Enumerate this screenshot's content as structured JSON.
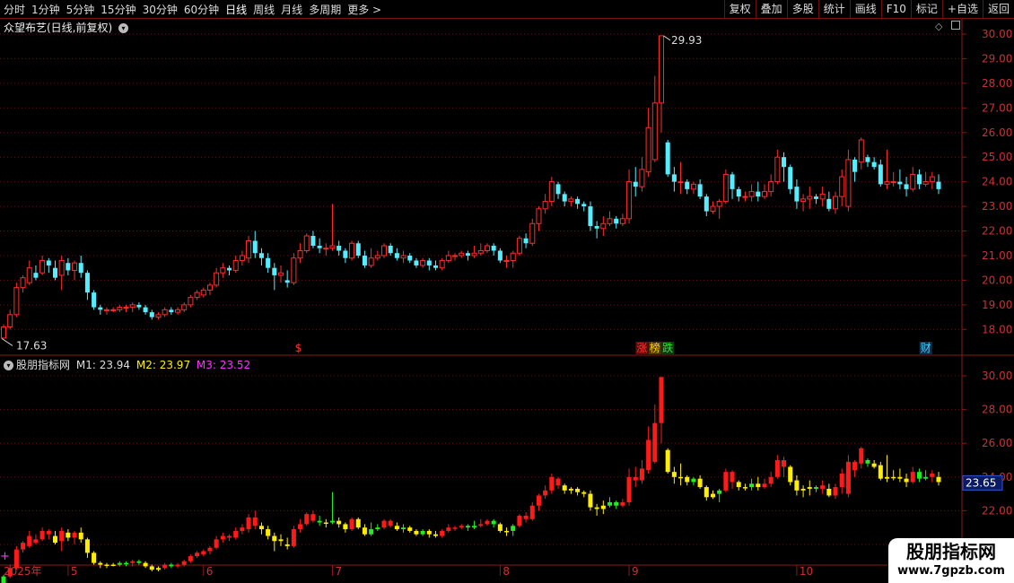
{
  "toolbar": {
    "periods": [
      {
        "label": "分时",
        "active": false
      },
      {
        "label": "1分钟",
        "active": false
      },
      {
        "label": "5分钟",
        "active": false
      },
      {
        "label": "15分钟",
        "active": false
      },
      {
        "label": "30分钟",
        "active": false
      },
      {
        "label": "60分钟",
        "active": false
      },
      {
        "label": "日线",
        "active": true
      },
      {
        "label": "周线",
        "active": false
      },
      {
        "label": "月线",
        "active": false
      },
      {
        "label": "多周期",
        "active": false
      },
      {
        "label": "更多 >",
        "active": false
      }
    ],
    "actions": [
      "复权",
      "叠加",
      "多股",
      "统计",
      "画线",
      "F10",
      "标记",
      "+自选",
      "返回"
    ]
  },
  "main_panel": {
    "title": "众望布艺(日线,前复权)",
    "price_labels": [
      "30.00",
      "29.00",
      "28.00",
      "27.00",
      "26.00",
      "25.00",
      "24.00",
      "23.00",
      "22.00",
      "21.00",
      "20.00",
      "19.00",
      "18.00"
    ],
    "high_label": "29.93",
    "low_label": "17.63",
    "markers": [
      {
        "text": "$",
        "color": "#ff3030",
        "after_candle": 46
      },
      {
        "text": "涨",
        "color": "#ff3030",
        "after_candle": 99,
        "bg": "#5a1010"
      },
      {
        "text": "榜",
        "color": "#ffcc00",
        "after_candle": 101,
        "bg": "#4a3800"
      },
      {
        "text": "跌",
        "color": "#33dd33",
        "after_candle": 103,
        "bg": "#103a10"
      },
      {
        "text": "财",
        "color": "#44ccff",
        "after_candle": 143,
        "bg": "#10304a"
      }
    ]
  },
  "indicator_panel": {
    "name": "股朋指标网",
    "m1_label": "M1: 23.94",
    "m2_label": "M2: 23.97",
    "m3_label": "M3: 23.52",
    "price_labels": [
      "30.00",
      "28.00",
      "26.00",
      "24.00",
      "22.00",
      "20.00"
    ],
    "current_value": "23.65"
  },
  "date_axis": {
    "labels": [
      "2025年",
      "5",
      "6",
      "7",
      "8",
      "9",
      "10"
    ]
  },
  "watermark": {
    "line1": "股朋指标网",
    "line2": "www.7gpzb.com"
  },
  "chart_data": {
    "type": "candlestick",
    "title": "众望布艺(日线,前复权)",
    "ylim": [
      17.1,
      30.4
    ],
    "colors": {
      "up": "#ff2c2c",
      "down": "#55eeff",
      "ind_red": "#ff1a1a",
      "ind_yellow": "#ffee00",
      "ind_green": "#22ee22"
    },
    "candles": [
      [
        17.65,
        18.1,
        18.2,
        17.63
      ],
      [
        18.1,
        18.6,
        18.8,
        18.0
      ],
      [
        18.6,
        19.7,
        19.9,
        18.5
      ],
      [
        19.7,
        20.1,
        20.2,
        19.5
      ],
      [
        19.9,
        20.5,
        20.8,
        19.8
      ],
      [
        20.3,
        20.1,
        20.6,
        20.0
      ],
      [
        20.3,
        20.8,
        21.0,
        20.2
      ],
      [
        20.8,
        20.6,
        20.9,
        20.3
      ],
      [
        20.5,
        20.1,
        20.8,
        20.0
      ],
      [
        20.2,
        20.8,
        21.0,
        19.6
      ],
      [
        20.7,
        20.4,
        20.9,
        20.2
      ],
      [
        20.4,
        20.7,
        20.8,
        20.0
      ],
      [
        20.7,
        20.3,
        21.0,
        20.1
      ],
      [
        20.3,
        19.5,
        20.4,
        19.2
      ],
      [
        19.5,
        18.9,
        19.6,
        18.8
      ],
      [
        18.9,
        18.8,
        19.0,
        18.6
      ],
      [
        18.8,
        18.8,
        18.9,
        18.6
      ],
      [
        18.8,
        18.8,
        18.9,
        18.7
      ],
      [
        18.8,
        18.9,
        19.0,
        18.7
      ],
      [
        18.9,
        18.9,
        19.0,
        18.7
      ],
      [
        18.9,
        19.0,
        19.1,
        18.7
      ],
      [
        19.0,
        18.9,
        19.1,
        18.8
      ],
      [
        18.9,
        18.7,
        19.0,
        18.6
      ],
      [
        18.7,
        18.5,
        18.8,
        18.4
      ],
      [
        18.5,
        18.6,
        18.7,
        18.4
      ],
      [
        18.6,
        18.8,
        18.9,
        18.5
      ],
      [
        18.8,
        18.7,
        18.9,
        18.6
      ],
      [
        18.7,
        18.8,
        18.9,
        18.6
      ],
      [
        18.8,
        19.0,
        19.1,
        18.7
      ],
      [
        19.0,
        19.3,
        19.4,
        18.9
      ],
      [
        19.3,
        19.5,
        19.6,
        19.2
      ],
      [
        19.4,
        19.6,
        19.7,
        19.3
      ],
      [
        19.6,
        19.8,
        19.9,
        19.4
      ],
      [
        19.8,
        20.3,
        20.5,
        19.7
      ],
      [
        20.3,
        20.5,
        20.7,
        20.1
      ],
      [
        20.5,
        20.4,
        20.6,
        20.2
      ],
      [
        20.4,
        20.8,
        21.0,
        20.3
      ],
      [
        20.8,
        21.0,
        21.2,
        20.6
      ],
      [
        20.9,
        21.6,
        21.8,
        20.7
      ],
      [
        21.6,
        21.1,
        22.0,
        20.9
      ],
      [
        21.1,
        20.9,
        21.3,
        20.6
      ],
      [
        20.9,
        20.5,
        21.1,
        20.3
      ],
      [
        20.5,
        20.2,
        20.7,
        19.6
      ],
      [
        20.2,
        20.3,
        20.6,
        19.9
      ],
      [
        20.0,
        19.9,
        20.4,
        19.7
      ],
      [
        19.9,
        20.9,
        21.1,
        19.8
      ],
      [
        20.9,
        21.2,
        21.5,
        20.7
      ],
      [
        21.2,
        21.8,
        21.9,
        21.1
      ],
      [
        21.8,
        21.4,
        22.0,
        21.3
      ],
      [
        21.4,
        21.3,
        21.7,
        21.1
      ],
      [
        21.3,
        21.3,
        21.5,
        21.0
      ],
      [
        21.3,
        21.4,
        23.1,
        21.2
      ],
      [
        21.4,
        21.2,
        21.6,
        21.0
      ],
      [
        21.2,
        20.9,
        21.3,
        20.7
      ],
      [
        20.9,
        21.5,
        21.6,
        20.8
      ],
      [
        21.5,
        21.0,
        21.6,
        20.9
      ],
      [
        21.0,
        20.6,
        21.2,
        20.5
      ],
      [
        20.6,
        20.9,
        21.3,
        20.5
      ],
      [
        20.9,
        21.0,
        21.2,
        20.8
      ],
      [
        21.0,
        21.4,
        21.5,
        20.9
      ],
      [
        21.4,
        21.1,
        21.5,
        21.0
      ],
      [
        21.1,
        20.9,
        21.3,
        20.8
      ],
      [
        20.9,
        21.0,
        21.2,
        20.7
      ],
      [
        21.0,
        20.8,
        21.1,
        20.7
      ],
      [
        20.8,
        20.6,
        20.9,
        20.5
      ],
      [
        20.6,
        20.8,
        20.9,
        20.5
      ],
      [
        20.8,
        20.6,
        20.9,
        20.4
      ],
      [
        20.6,
        20.5,
        20.8,
        20.4
      ],
      [
        20.5,
        20.8,
        20.9,
        20.4
      ],
      [
        20.8,
        21.0,
        21.2,
        20.7
      ],
      [
        21.0,
        21.0,
        21.1,
        20.8
      ],
      [
        21.0,
        21.1,
        21.2,
        20.9
      ],
      [
        21.1,
        21.0,
        21.2,
        20.8
      ],
      [
        21.0,
        21.1,
        21.4,
        20.9
      ],
      [
        21.1,
        21.2,
        21.5,
        21.0
      ],
      [
        21.2,
        21.4,
        21.5,
        21.1
      ],
      [
        21.4,
        21.2,
        21.5,
        21.0
      ],
      [
        21.2,
        20.8,
        21.3,
        20.7
      ],
      [
        20.8,
        20.8,
        21.0,
        20.5
      ],
      [
        20.8,
        21.1,
        21.2,
        20.5
      ],
      [
        21.1,
        21.7,
        21.8,
        21.0
      ],
      [
        21.7,
        21.5,
        21.9,
        21.3
      ],
      [
        21.5,
        22.3,
        22.5,
        21.4
      ],
      [
        22.3,
        22.9,
        23.0,
        22.0
      ],
      [
        22.9,
        23.2,
        23.5,
        22.7
      ],
      [
        23.2,
        24.0,
        24.2,
        23.0
      ],
      [
        23.9,
        23.5,
        24.0,
        23.3
      ],
      [
        23.5,
        23.2,
        23.6,
        23.0
      ],
      [
        23.2,
        23.3,
        23.4,
        23.0
      ],
      [
        23.3,
        23.1,
        23.4,
        22.9
      ],
      [
        23.1,
        23.0,
        23.2,
        22.8
      ],
      [
        23.0,
        22.2,
        23.2,
        22.0
      ],
      [
        22.2,
        22.1,
        22.4,
        21.7
      ],
      [
        22.1,
        22.3,
        22.6,
        21.8
      ],
      [
        22.3,
        22.5,
        22.8,
        22.2
      ],
      [
        22.5,
        22.3,
        22.6,
        22.1
      ],
      [
        22.3,
        22.5,
        22.7,
        22.2
      ],
      [
        22.5,
        24.0,
        24.5,
        22.3
      ],
      [
        24.0,
        23.8,
        24.6,
        23.4
      ],
      [
        23.8,
        24.5,
        25.0,
        23.6
      ],
      [
        24.4,
        26.2,
        27.0,
        24.2
      ],
      [
        24.9,
        27.2,
        28.3,
        24.8
      ],
      [
        27.2,
        29.93,
        29.93,
        26.0
      ],
      [
        25.6,
        24.3,
        25.7,
        24.2
      ],
      [
        24.3,
        24.0,
        24.6,
        23.6
      ],
      [
        24.0,
        24.0,
        24.8,
        23.5
      ],
      [
        24.0,
        23.7,
        24.1,
        23.5
      ],
      [
        23.7,
        23.9,
        24.0,
        23.5
      ],
      [
        23.9,
        23.4,
        24.1,
        23.3
      ],
      [
        23.4,
        22.8,
        23.5,
        22.6
      ],
      [
        22.8,
        23.0,
        23.2,
        22.7
      ],
      [
        23.0,
        23.2,
        23.3,
        22.5
      ],
      [
        23.2,
        24.3,
        24.5,
        23.1
      ],
      [
        24.3,
        23.7,
        24.4,
        23.3
      ],
      [
        23.7,
        23.4,
        23.8,
        23.2
      ],
      [
        23.4,
        23.4,
        23.6,
        23.2
      ],
      [
        23.4,
        23.6,
        23.9,
        23.2
      ],
      [
        23.6,
        23.4,
        24.0,
        23.2
      ],
      [
        23.4,
        23.6,
        23.9,
        23.3
      ],
      [
        23.6,
        24.0,
        24.3,
        23.4
      ],
      [
        24.0,
        25.0,
        25.3,
        23.9
      ],
      [
        25.0,
        24.6,
        25.2,
        24.0
      ],
      [
        24.6,
        23.7,
        24.7,
        23.5
      ],
      [
        23.8,
        23.2,
        24.1,
        22.9
      ],
      [
        23.2,
        23.3,
        23.5,
        22.8
      ],
      [
        23.3,
        23.4,
        23.8,
        22.9
      ],
      [
        23.4,
        23.3,
        23.5,
        23.1
      ],
      [
        23.3,
        23.5,
        23.8,
        23.0
      ],
      [
        23.3,
        22.9,
        23.6,
        22.8
      ],
      [
        22.9,
        23.4,
        23.6,
        22.7
      ],
      [
        23.4,
        24.2,
        24.5,
        23.0
      ],
      [
        23.0,
        24.9,
        25.3,
        22.8
      ],
      [
        24.9,
        24.4,
        25.0,
        24.0
      ],
      [
        24.8,
        25.7,
        25.8,
        24.5
      ],
      [
        25.0,
        24.8,
        25.1,
        24.6
      ],
      [
        24.8,
        24.6,
        25.0,
        24.5
      ],
      [
        24.7,
        23.9,
        24.9,
        23.8
      ],
      [
        23.9,
        24.0,
        25.3,
        23.7
      ],
      [
        24.0,
        24.0,
        24.4,
        23.8
      ],
      [
        24.0,
        23.9,
        24.5,
        23.7
      ],
      [
        23.9,
        23.7,
        24.2,
        23.4
      ],
      [
        23.7,
        24.3,
        24.6,
        23.6
      ],
      [
        24.3,
        23.9,
        24.5,
        23.7
      ],
      [
        23.9,
        24.0,
        24.4,
        23.8
      ],
      [
        24.0,
        24.2,
        24.4,
        23.7
      ],
      [
        24.0,
        23.7,
        24.3,
        23.5
      ]
    ],
    "indicator": {
      "m1": 23.94,
      "m2": 23.97,
      "m3": 23.52,
      "current": 23.65,
      "ylim": [
        19.2,
        30.8
      ]
    }
  }
}
